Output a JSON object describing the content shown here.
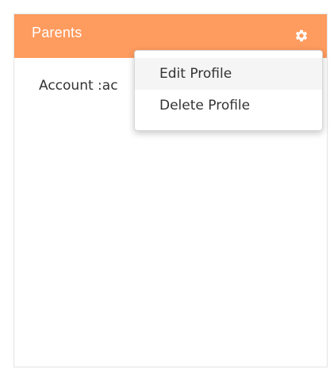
{
  "panel": {
    "title": "Parents",
    "header_color": "#fe9b5e",
    "settings_icon": "gear-icon",
    "body_text": "Account :ac"
  },
  "dropdown": {
    "items": [
      {
        "label": "Edit Profile",
        "hovered": true
      },
      {
        "label": "Delete Profile",
        "hovered": false
      }
    ]
  }
}
